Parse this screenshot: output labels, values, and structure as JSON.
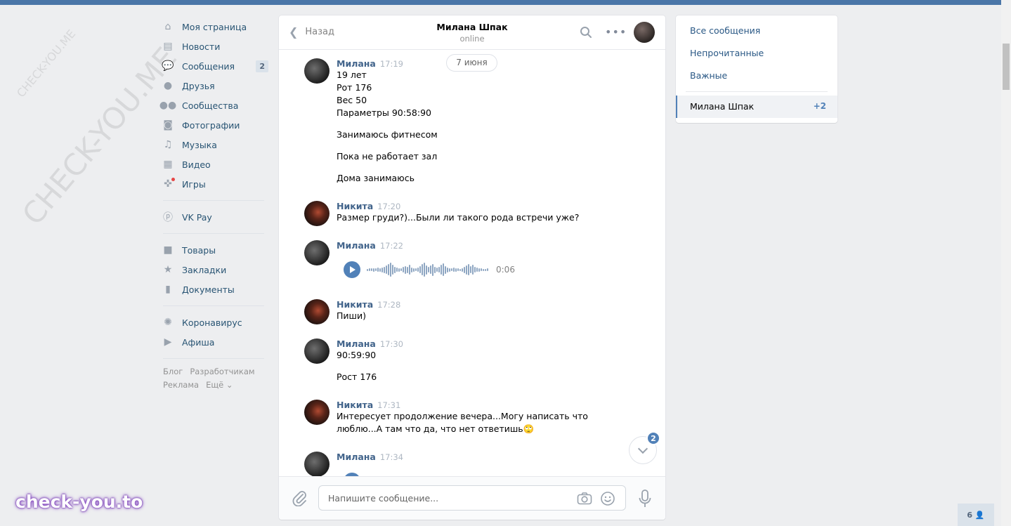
{
  "watermarks": {
    "small": "CHECK-YOU.ME",
    "large": "CHECK-YOU.ME",
    "brand": "check-you.to"
  },
  "leftnav": {
    "items": [
      {
        "label": "Моя страница",
        "icon": "home-icon"
      },
      {
        "label": "Новости",
        "icon": "news-icon"
      },
      {
        "label": "Сообщения",
        "icon": "chat-bubbles-icon",
        "badge": "2"
      },
      {
        "label": "Друзья",
        "icon": "user-icon"
      },
      {
        "label": "Сообщества",
        "icon": "users-icon"
      },
      {
        "label": "Фотографии",
        "icon": "camera-icon"
      },
      {
        "label": "Музыка",
        "icon": "music-note-icon"
      },
      {
        "label": "Видео",
        "icon": "film-icon"
      },
      {
        "label": "Игры",
        "icon": "gamepad-icon"
      },
      {
        "label": "VK Pay",
        "icon": "ruble-coin-icon"
      },
      {
        "label": "Товары",
        "icon": "shopping-bag-icon"
      },
      {
        "label": "Закладки",
        "icon": "star-icon"
      },
      {
        "label": "Документы",
        "icon": "document-icon"
      },
      {
        "label": "Коронавирус",
        "icon": "virus-icon"
      },
      {
        "label": "Афиша",
        "icon": "play-square-icon"
      }
    ],
    "footer": {
      "blog": "Блог",
      "developers": "Разработчикам",
      "ads": "Реклама",
      "more": "Ещё ⌄"
    }
  },
  "chat": {
    "back_label": "Назад",
    "peer_name": "Милана Шпак",
    "peer_status": "online",
    "date_label": "7 июня",
    "messages": [
      {
        "author": "Милана",
        "time": "17:19",
        "lines": [
          "19 лет",
          "Рот 176",
          "Вес 50",
          "Параметры 90:58:90",
          "Занимаюсь фитнесом",
          "Пока не работает зал",
          "Дома занимаюсь"
        ]
      },
      {
        "author": "Никита",
        "time": "17:20",
        "lines": [
          "Размер груди?)...Были ли такого рода встречи уже?"
        ]
      },
      {
        "author": "Милана",
        "time": "17:22",
        "voice_duration": "0:06"
      },
      {
        "author": "Никита",
        "time": "17:28",
        "lines": [
          "Пиши)"
        ]
      },
      {
        "author": "Милана",
        "time": "17:30",
        "lines": [
          "90:59:90",
          "Рост 176"
        ]
      },
      {
        "author": "Никита",
        "time": "17:31",
        "lines": [
          "Интересует продолжение вечера...Могу написать что",
          "люблю...А там что да, что нет ответишь🙄"
        ]
      },
      {
        "author": "Милана",
        "time": "17:34"
      }
    ],
    "unread_badge": "2",
    "composer_placeholder": "Напишите сообщение..."
  },
  "rightpanel": {
    "all": "Все сообщения",
    "unread": "Непрочитанные",
    "important": "Важные",
    "active_chat": "Милана Шпак",
    "active_count": "+2"
  },
  "online_chip": "6 👤",
  "colors": {
    "header_blue": "#4a76a8",
    "link": "#2a5885",
    "author": "#42648b",
    "accent": "#5181b8"
  }
}
